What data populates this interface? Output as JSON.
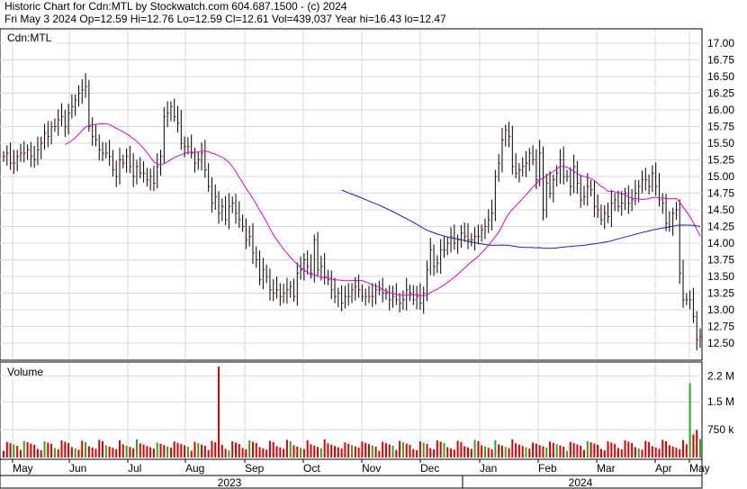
{
  "header": {
    "line1": "Historic Chart for Cdn:MTL by Stockwatch.com 604.687.1500 - (c) 2024",
    "line2": "Fri May  3 2024   Op=12.59   Hi=12.76   Lo=12.59   Cl=12.61   Vol=439,037   Year hi=16.43   lo=12.47"
  },
  "chart_data": [
    {
      "type": "ohlc",
      "title": "Cdn:MTL",
      "ylim": [
        12.35,
        17.1
      ],
      "yticks": [
        "17.00",
        "16.75",
        "16.50",
        "16.25",
        "16.00",
        "15.75",
        "15.50",
        "15.25",
        "15.00",
        "14.75",
        "14.50",
        "14.25",
        "14.00",
        "13.75",
        "13.50",
        "13.25",
        "13.00",
        "12.75",
        "12.50"
      ],
      "months": [
        "May",
        "Jun",
        "Jul",
        "Aug",
        "Sep",
        "Oct",
        "Nov",
        "Dec",
        "Jan",
        "Feb",
        "Mar",
        "Apr",
        "May"
      ],
      "years": [
        "2023",
        "2024"
      ],
      "grid": true,
      "series": [
        {
          "type": "ohlc",
          "close": [
            15.3,
            15.35,
            15.2,
            15.2,
            15.3,
            15.35,
            15.35,
            15.4,
            15.3,
            15.25,
            15.4,
            15.5,
            15.65,
            15.6,
            15.75,
            15.75,
            15.85,
            15.9,
            15.75,
            15.95,
            16.05,
            16.15,
            16.25,
            16.3,
            16.35,
            15.75,
            15.6,
            15.55,
            15.4,
            15.35,
            15.35,
            15.3,
            15.1,
            15.0,
            15.25,
            15.2,
            15.3,
            15.15,
            15.0,
            15.15,
            15.05,
            15.05,
            14.95,
            15.0,
            14.9,
            15.15,
            15.3,
            15.9,
            15.95,
            16.05,
            15.9,
            15.8,
            15.5,
            15.45,
            15.45,
            15.35,
            15.2,
            15.25,
            15.35,
            15.1,
            14.85,
            14.6,
            14.7,
            14.45,
            14.55,
            14.35,
            14.55,
            14.6,
            14.45,
            14.35,
            14.25,
            14.05,
            14.1,
            13.85,
            13.75,
            13.45,
            13.6,
            13.5,
            13.3,
            13.25,
            13.3,
            13.2,
            13.25,
            13.3,
            13.35,
            13.2,
            13.55,
            13.6,
            13.75,
            13.65,
            13.55,
            14.05,
            13.6,
            13.65,
            13.5,
            13.45,
            13.3,
            13.2,
            13.25,
            13.1,
            13.2,
            13.2,
            13.3,
            13.35,
            13.3,
            13.2,
            13.2,
            13.2,
            13.2,
            13.3,
            13.3,
            13.25,
            13.25,
            13.15,
            13.2,
            13.15,
            13.1,
            13.15,
            13.3,
            13.25,
            13.15,
            13.2,
            13.1,
            13.25,
            13.6,
            13.9,
            13.65,
            13.7,
            13.9,
            13.9,
            14.0,
            14.1,
            14.0,
            14.05,
            14.15,
            14.1,
            14.05,
            14.05,
            14.1,
            14.1,
            14.2,
            14.25,
            14.35,
            14.45,
            15.0,
            15.2,
            15.55,
            15.7,
            15.6,
            15.15,
            15.05,
            15.1,
            15.15,
            15.2,
            15.35,
            15.25,
            14.95,
            15.35,
            14.5,
            14.9,
            14.75,
            14.95,
            15.05,
            15.25,
            15.0,
            15.0,
            14.85,
            15.15,
            14.9,
            14.65,
            14.7,
            14.85,
            14.8,
            14.55,
            14.5,
            14.35,
            14.45,
            14.4,
            14.6,
            14.65,
            14.55,
            14.6,
            14.75,
            14.6,
            14.65,
            14.75,
            14.85,
            14.95,
            14.95,
            14.85,
            15.05,
            14.85,
            14.65,
            14.6,
            14.3,
            14.25,
            14.45,
            14.5,
            13.55,
            13.15,
            13.15,
            13.15,
            12.9,
            12.55,
            12.6
          ]
        },
        {
          "name": "",
          "type": "line",
          "window": 20,
          "color": "#dd00dd"
        },
        {
          "name": "",
          "type": "line",
          "window": 100,
          "color": "#1a1acc"
        }
      ]
    },
    {
      "type": "bar",
      "title": "Volume",
      "yticks": [
        "2.2 M",
        "1.5 M",
        "750 k"
      ],
      "ylim": [
        0,
        2500000
      ],
      "highlight_values": [
        {
          "index": 63,
          "value": 2450000
        },
        {
          "index": 201,
          "value": 2000000
        }
      ],
      "series": [
        {
          "name": "",
          "color": "#dd0000",
          "up_color": "#22aa22"
        }
      ]
    }
  ]
}
